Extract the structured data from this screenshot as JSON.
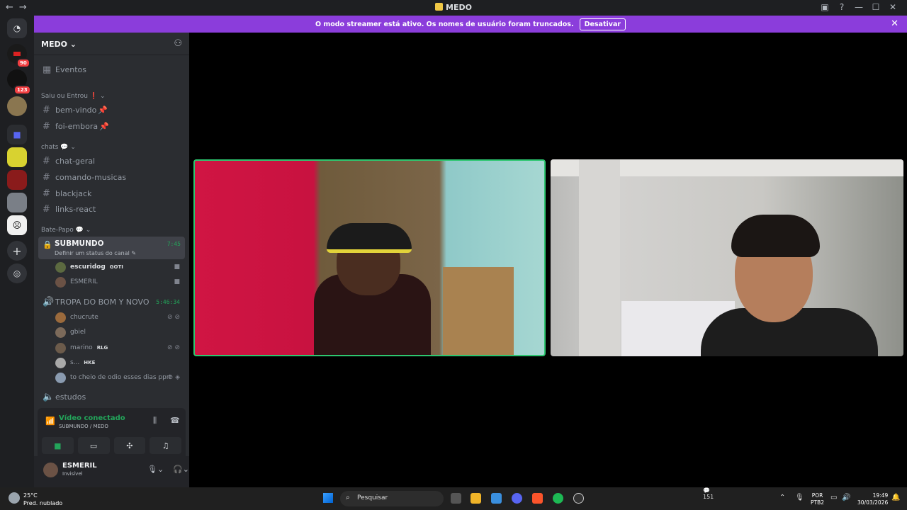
{
  "window": {
    "title": "MEDO",
    "back": "←",
    "forward": "→"
  },
  "banner": {
    "text": "O modo streamer está ativo. Os nomes de usuário foram truncados.",
    "button": "Desativar",
    "close": "✕"
  },
  "guilds": {
    "badges": [
      "90",
      "123"
    ],
    "items": [
      "server-red",
      "server-dark",
      "server-gold",
      "folder",
      "server-meds",
      "server-red2",
      "server-gray",
      "server-face"
    ]
  },
  "server": {
    "name": "MEDO"
  },
  "sidebar": {
    "events": "Eventos",
    "categories": [
      {
        "name": "Saiu ou Entrou",
        "channels": [
          "bem-vindo",
          "foi-embora"
        ]
      },
      {
        "name": "chats",
        "channels": [
          "chat-geral",
          "comando-musicas",
          "blackjack",
          "links-react"
        ]
      },
      {
        "name": "Bate-Papo"
      }
    ],
    "active_voice": {
      "name": "SUBMUNDO",
      "status": "Definir um status do canal",
      "time": "7:45",
      "members": [
        {
          "name": "escuridog",
          "tag": "GOTI"
        },
        {
          "name": "ESMERIL",
          "tag": ""
        }
      ]
    },
    "voice2": {
      "name": "TROPA DO BOM Y NOVO",
      "time": "5:46:34",
      "members": [
        {
          "name": "chucrute",
          "tag": ""
        },
        {
          "name": "gbiel",
          "tag": ""
        },
        {
          "name": "marino",
          "tag": "RLG"
        },
        {
          "name": "s...",
          "tag": "HKE"
        },
        {
          "name": "to cheio de odio esses dias pprt",
          "tag": ""
        }
      ]
    },
    "voice3": {
      "name": "estudos"
    }
  },
  "voice_panel": {
    "status": "Vídeo conectado",
    "location": "SUBMUNDO / MEDO"
  },
  "user_panel": {
    "name": "ESMERIL",
    "status": "Invisível"
  },
  "taskbar": {
    "temp": "25°C",
    "weather": "Pred. nublado",
    "search": "Pesquisar",
    "lang1": "POR",
    "lang2": "PTB2",
    "time": "19:49",
    "date": "30/03/2026",
    "chat_count": "151"
  }
}
